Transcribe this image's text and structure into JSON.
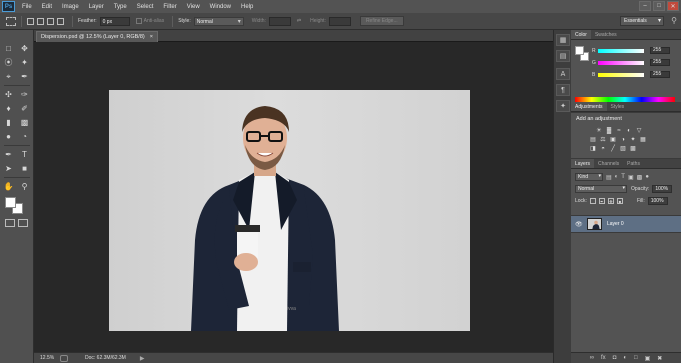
{
  "app": {
    "logo": "Ps",
    "menu": [
      "File",
      "Edit",
      "Image",
      "Layer",
      "Type",
      "Select",
      "Filter",
      "View",
      "Window",
      "Help"
    ],
    "window_buttons": [
      "–",
      "□",
      "✕"
    ]
  },
  "options_bar": {
    "feather_label": "Feather:",
    "feather_value": "0 px",
    "anti_alias_label": "Anti-alias",
    "style_label": "Style:",
    "style_value": "Normal",
    "width_label": "Width:",
    "height_label": "Height:",
    "refine_edge_label": "Refine Edge...",
    "workspace": "Essentials"
  },
  "document": {
    "tab_title": "Dispersion.psd @ 12.5% (Layer 0, RGB/8)",
    "tab_close": "×",
    "watermark": "ivva"
  },
  "status_bar": {
    "zoom": "12.5%",
    "doc_info": "Doc: 62.3M/62.3M",
    "arrow": "▶"
  },
  "color_panel": {
    "tabs": [
      "Color",
      "Swatches"
    ],
    "sliders": [
      {
        "label": "R",
        "value": "255",
        "gradient": "linear-gradient(90deg,#00ffff,#ffffff)"
      },
      {
        "label": "G",
        "value": "255",
        "gradient": "linear-gradient(90deg,#ff00ff,#ffffff)"
      },
      {
        "label": "B",
        "value": "255",
        "gradient": "linear-gradient(90deg,#ffff00,#ffffff)"
      }
    ]
  },
  "adjustments_panel": {
    "tabs": [
      "Adjustments",
      "Styles"
    ],
    "title": "Add an adjustment",
    "row1_icons": [
      "☀",
      "▓",
      "≈",
      "◐",
      "▽"
    ],
    "row2_icons": [
      "▤",
      "⚖",
      "▣",
      "◑",
      "✦",
      "▦"
    ],
    "row3_icons": [
      "◨",
      "◓",
      "╱",
      "▧",
      "▩"
    ]
  },
  "layers_panel": {
    "tabs": [
      "Layers",
      "Channels",
      "Paths"
    ],
    "filter_kind": "Kind",
    "blend_mode": "Normal",
    "opacity_label": "Opacity:",
    "opacity_value": "100%",
    "lock_label": "Lock:",
    "fill_label": "Fill:",
    "fill_value": "100%",
    "layer_name": "Layer 0",
    "footer_icons": [
      "∞",
      "fx",
      "◘",
      "◐",
      "□",
      "▣",
      "✖"
    ]
  },
  "colors": {
    "panel_bg": "#535353",
    "canvas_bg": "#282828",
    "layer_selected": "#5e6f84",
    "foreground": "#ffffff",
    "background": "#ffffff"
  }
}
